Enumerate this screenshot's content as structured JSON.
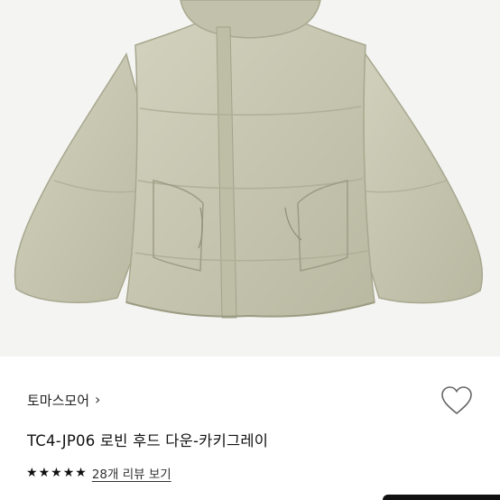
{
  "product": {
    "image_alt": "jacket-photo",
    "brand": "토마스모어",
    "brand_chevron": "›",
    "title": "TC4-JP06 로빈 후드 다운-카키그레이",
    "rating_stars": 5,
    "review_link": "28개 리뷰 보기"
  },
  "icons": {
    "wish": "heart-outline-icon",
    "star": "star-icon",
    "chevron": "chevron-right-icon"
  },
  "colors": {
    "jacket": "#c9c8b3",
    "jacket_shadow": "#a8a78f",
    "background": "#f4f4f2",
    "text": "#111111"
  }
}
